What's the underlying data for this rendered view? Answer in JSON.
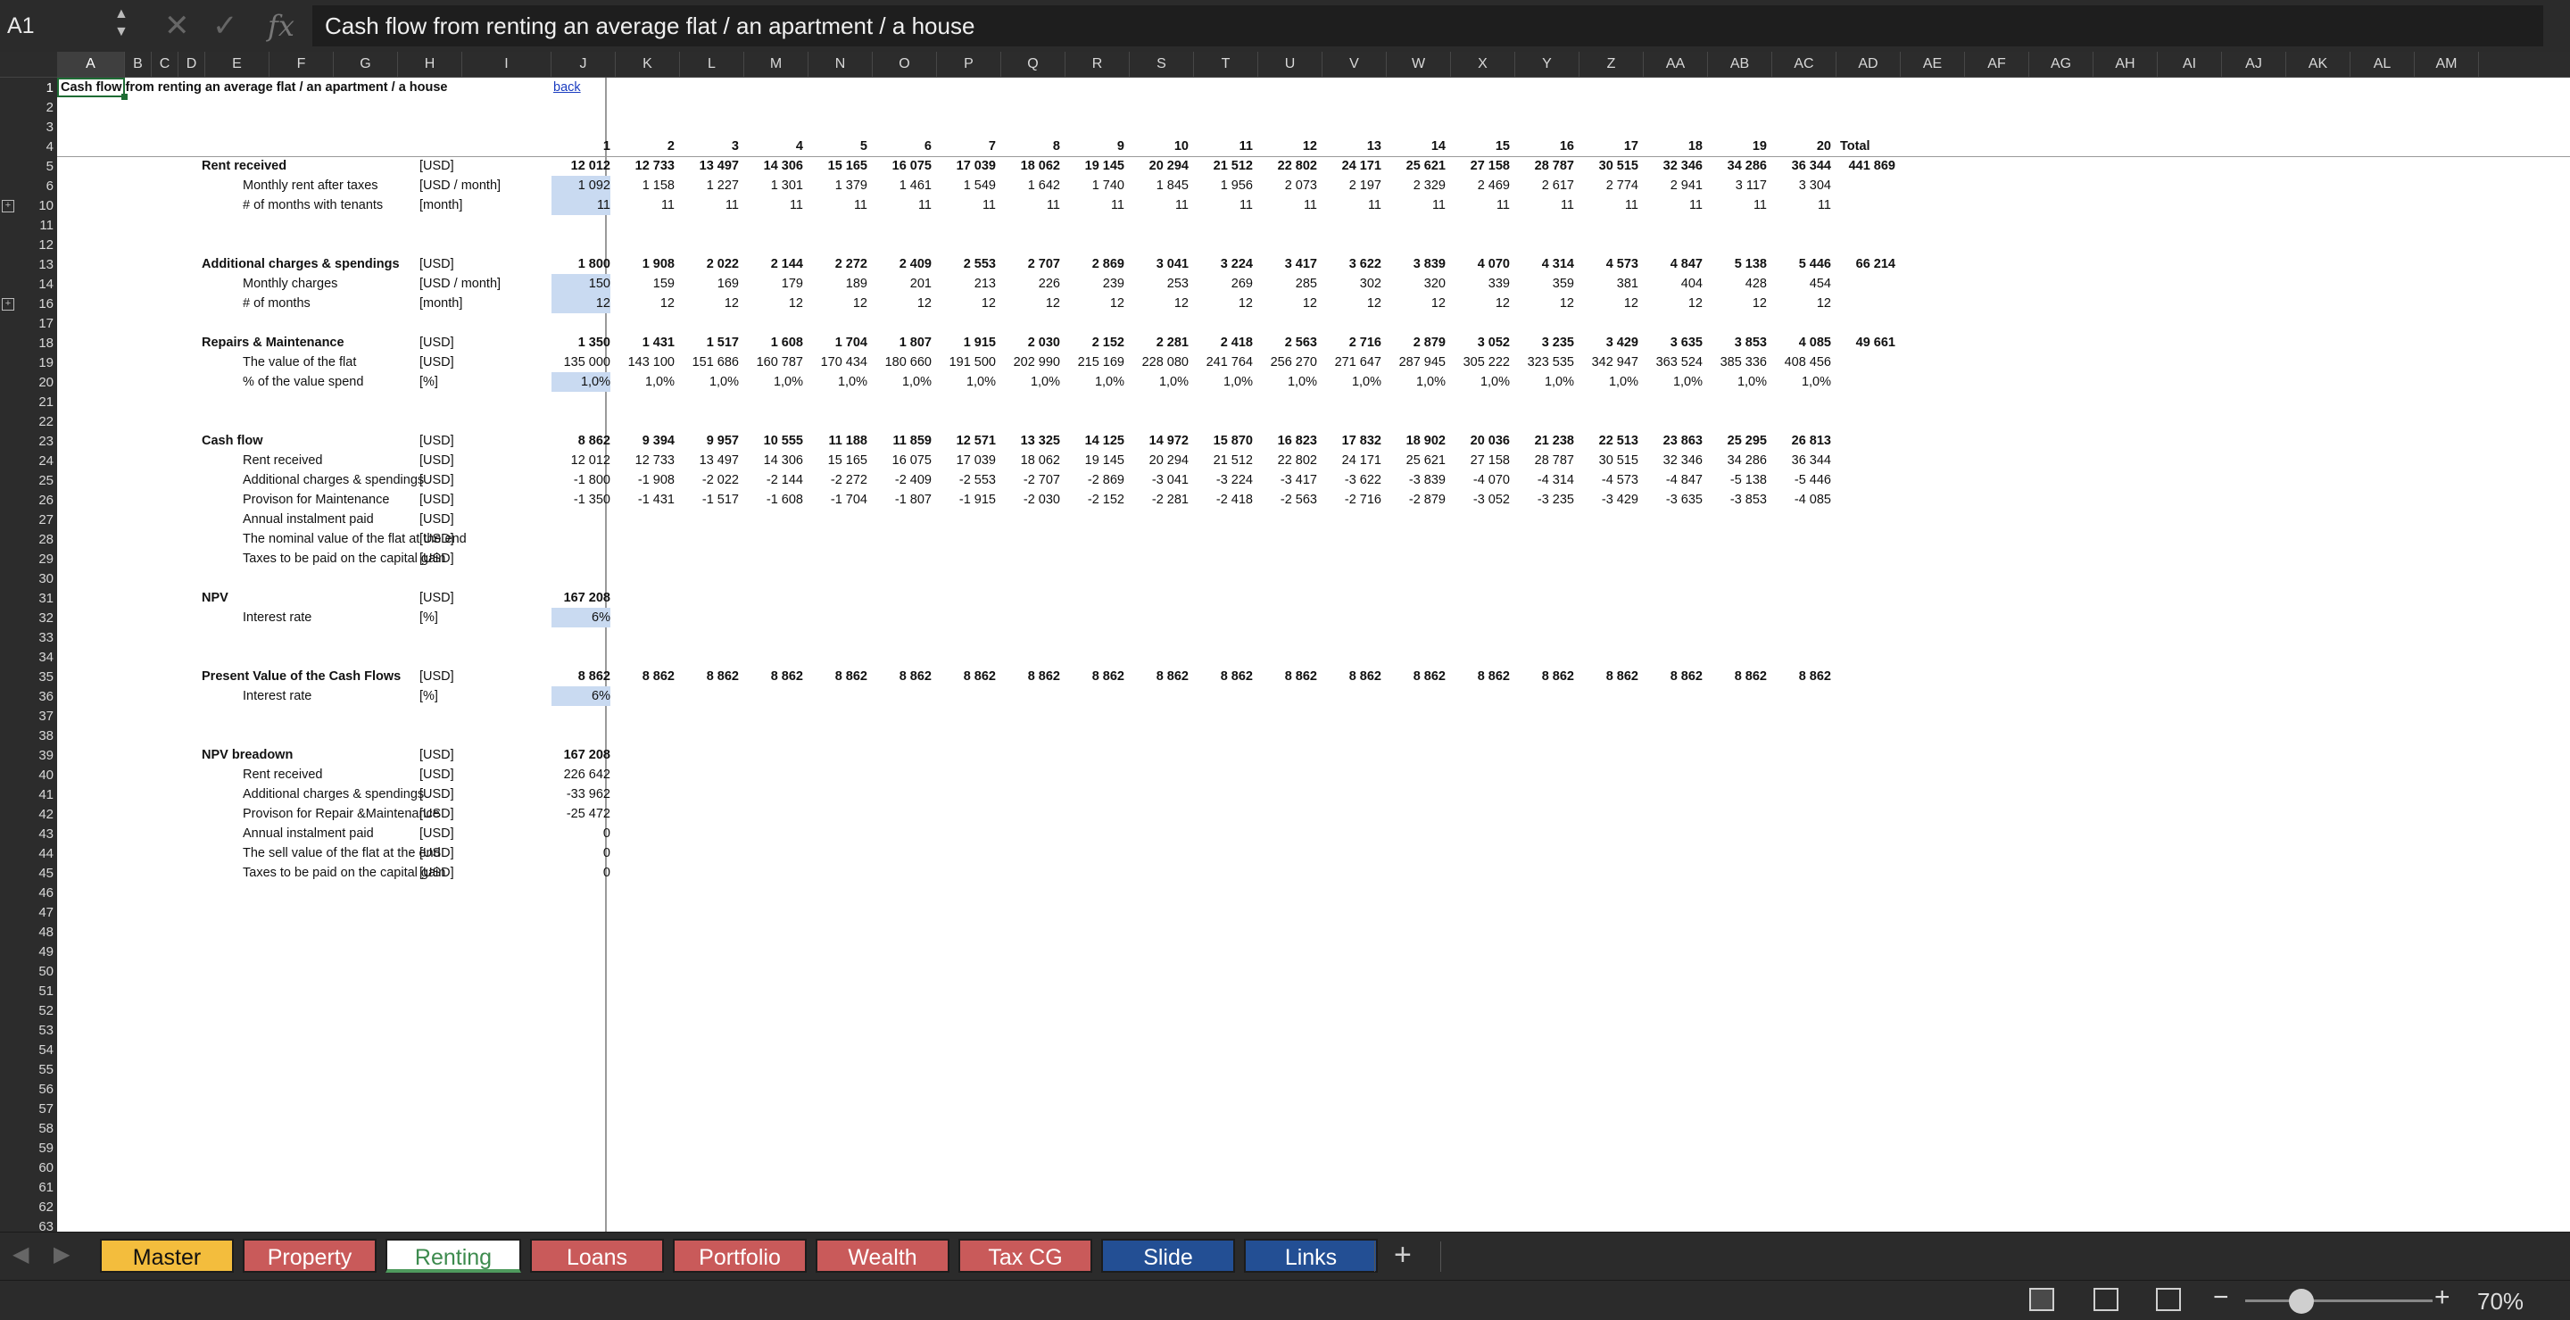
{
  "formula_bar": {
    "cell_ref": "A1",
    "formula": "Cash flow from renting an average flat / an apartment / a house",
    "fx_label": "fx",
    "cancel_icon": "x-icon",
    "enter_icon": "check-icon"
  },
  "outline_levels": [
    "1",
    "2"
  ],
  "columns": [
    "A",
    "B",
    "C",
    "D",
    "E",
    "F",
    "G",
    "H",
    "I",
    "J",
    "K",
    "L",
    "M",
    "N",
    "O",
    "P",
    "Q",
    "R",
    "S",
    "T",
    "U",
    "V",
    "W",
    "X",
    "Y",
    "Z",
    "AA",
    "AB",
    "AC",
    "AD",
    "AE",
    "AF",
    "AG",
    "AH",
    "AI",
    "AJ",
    "AK",
    "AL",
    "AM"
  ],
  "row_numbers": [
    "1",
    "2",
    "3",
    "4",
    "5",
    "6",
    "10",
    "11",
    "12",
    "13",
    "14",
    "16",
    "17",
    "18",
    "19",
    "20",
    "21",
    "22",
    "23",
    "24",
    "25",
    "26",
    "27",
    "28",
    "29",
    "30",
    "31",
    "32",
    "33",
    "34",
    "35",
    "36",
    "37",
    "38",
    "39",
    "40",
    "41",
    "42",
    "43",
    "44",
    "45",
    "46",
    "47",
    "48",
    "49",
    "50",
    "51",
    "52",
    "53",
    "54",
    "55",
    "56",
    "57",
    "58",
    "59",
    "60",
    "61",
    "62",
    "63"
  ],
  "sheet": {
    "title": "Cash flow from renting an average flat / an apartment / a house",
    "back_link": "back",
    "years": [
      "1",
      "2",
      "3",
      "4",
      "5",
      "6",
      "7",
      "8",
      "9",
      "10",
      "11",
      "12",
      "13",
      "14",
      "15",
      "16",
      "17",
      "18",
      "19",
      "20"
    ],
    "total_label": "Total",
    "rows": [
      {
        "row": "5",
        "label": "Rent received",
        "unit": "[USD]",
        "bold": true,
        "values": [
          "12 012",
          "12 733",
          "13 497",
          "14 306",
          "15 165",
          "16 075",
          "17 039",
          "18 062",
          "19 145",
          "20 294",
          "21 512",
          "22 802",
          "24 171",
          "25 621",
          "27 158",
          "28 787",
          "30 515",
          "32 346",
          "34 286",
          "36 344"
        ],
        "total": "441 869"
      },
      {
        "row": "6",
        "label": "Monthly rent after taxes",
        "unit": "[USD / month]",
        "indent": true,
        "hl": true,
        "values": [
          "1 092",
          "1 158",
          "1 227",
          "1 301",
          "1 379",
          "1 461",
          "1 549",
          "1 642",
          "1 740",
          "1 845",
          "1 956",
          "2 073",
          "2 197",
          "2 329",
          "2 469",
          "2 617",
          "2 774",
          "2 941",
          "3 117",
          "3 304"
        ]
      },
      {
        "row": "10",
        "label": "# of months with tenants",
        "unit": "[month]",
        "indent": true,
        "hl": true,
        "values": [
          "11",
          "11",
          "11",
          "11",
          "11",
          "11",
          "11",
          "11",
          "11",
          "11",
          "11",
          "11",
          "11",
          "11",
          "11",
          "11",
          "11",
          "11",
          "11",
          "11"
        ]
      },
      {
        "row": "13",
        "label": "Additional charges & spendings",
        "unit": "[USD]",
        "bold": true,
        "values": [
          "1 800",
          "1 908",
          "2 022",
          "2 144",
          "2 272",
          "2 409",
          "2 553",
          "2 707",
          "2 869",
          "3 041",
          "3 224",
          "3 417",
          "3 622",
          "3 839",
          "4 070",
          "4 314",
          "4 573",
          "4 847",
          "5 138",
          "5 446"
        ],
        "total": "66 214"
      },
      {
        "row": "14",
        "label": "Monthly charges",
        "unit": "[USD / month]",
        "indent": true,
        "hl": true,
        "values": [
          "150",
          "159",
          "169",
          "179",
          "189",
          "201",
          "213",
          "226",
          "239",
          "253",
          "269",
          "285",
          "302",
          "320",
          "339",
          "359",
          "381",
          "404",
          "428",
          "454"
        ]
      },
      {
        "row": "16",
        "label": "# of months",
        "unit": "[month]",
        "indent": true,
        "hl": true,
        "values": [
          "12",
          "12",
          "12",
          "12",
          "12",
          "12",
          "12",
          "12",
          "12",
          "12",
          "12",
          "12",
          "12",
          "12",
          "12",
          "12",
          "12",
          "12",
          "12",
          "12"
        ]
      },
      {
        "row": "18",
        "label": "Repairs & Maintenance",
        "unit": "[USD]",
        "bold": true,
        "values": [
          "1 350",
          "1 431",
          "1 517",
          "1 608",
          "1 704",
          "1 807",
          "1 915",
          "2 030",
          "2 152",
          "2 281",
          "2 418",
          "2 563",
          "2 716",
          "2 879",
          "3 052",
          "3 235",
          "3 429",
          "3 635",
          "3 853",
          "4 085"
        ],
        "total": "49 661"
      },
      {
        "row": "19",
        "label": "The value of the flat",
        "unit": "[USD]",
        "indent": true,
        "values": [
          "135 000",
          "143 100",
          "151 686",
          "160 787",
          "170 434",
          "180 660",
          "191 500",
          "202 990",
          "215 169",
          "228 080",
          "241 764",
          "256 270",
          "271 647",
          "287 945",
          "305 222",
          "323 535",
          "342 947",
          "363 524",
          "385 336",
          "408 456"
        ]
      },
      {
        "row": "20",
        "label": "% of the value spend",
        "unit": "[%]",
        "indent": true,
        "hl": true,
        "values": [
          "1,0%",
          "1,0%",
          "1,0%",
          "1,0%",
          "1,0%",
          "1,0%",
          "1,0%",
          "1,0%",
          "1,0%",
          "1,0%",
          "1,0%",
          "1,0%",
          "1,0%",
          "1,0%",
          "1,0%",
          "1,0%",
          "1,0%",
          "1,0%",
          "1,0%",
          "1,0%"
        ]
      },
      {
        "row": "23",
        "label": "Cash flow",
        "unit": "[USD]",
        "bold": true,
        "values": [
          "8 862",
          "9 394",
          "9 957",
          "10 555",
          "11 188",
          "11 859",
          "12 571",
          "13 325",
          "14 125",
          "14 972",
          "15 870",
          "16 823",
          "17 832",
          "18 902",
          "20 036",
          "21 238",
          "22 513",
          "23 863",
          "25 295",
          "26 813"
        ]
      },
      {
        "row": "24",
        "label": "Rent received",
        "unit": "[USD]",
        "indent": true,
        "values": [
          "12 012",
          "12 733",
          "13 497",
          "14 306",
          "15 165",
          "16 075",
          "17 039",
          "18 062",
          "19 145",
          "20 294",
          "21 512",
          "22 802",
          "24 171",
          "25 621",
          "27 158",
          "28 787",
          "30 515",
          "32 346",
          "34 286",
          "36 344"
        ]
      },
      {
        "row": "25",
        "label": "Additional charges & spendings",
        "unit": "[USD]",
        "indent": true,
        "values": [
          "-1 800",
          "-1 908",
          "-2 022",
          "-2 144",
          "-2 272",
          "-2 409",
          "-2 553",
          "-2 707",
          "-2 869",
          "-3 041",
          "-3 224",
          "-3 417",
          "-3 622",
          "-3 839",
          "-4 070",
          "-4 314",
          "-4 573",
          "-4 847",
          "-5 138",
          "-5 446"
        ]
      },
      {
        "row": "26",
        "label": "Provison for Maintenance",
        "unit": "[USD]",
        "indent": true,
        "values": [
          "-1 350",
          "-1 431",
          "-1 517",
          "-1 608",
          "-1 704",
          "-1 807",
          "-1 915",
          "-2 030",
          "-2 152",
          "-2 281",
          "-2 418",
          "-2 563",
          "-2 716",
          "-2 879",
          "-3 052",
          "-3 235",
          "-3 429",
          "-3 635",
          "-3 853",
          "-4 085"
        ]
      },
      {
        "row": "27",
        "label": "Annual instalment paid",
        "unit": "[USD]",
        "indent": true,
        "values": []
      },
      {
        "row": "28",
        "label": "The nominal value of the flat at the end",
        "unit": "[USD]",
        "indent": true,
        "values": []
      },
      {
        "row": "29",
        "label": "Taxes to be paid on the capital gain",
        "unit": "[USD]",
        "indent": true,
        "values": []
      },
      {
        "row": "31",
        "label": "NPV",
        "unit": "[USD]",
        "bold": true,
        "values": [
          "167 208"
        ]
      },
      {
        "row": "32",
        "label": "Interest rate",
        "unit": "[%]",
        "indent": true,
        "hl": true,
        "values": [
          "6%"
        ]
      },
      {
        "row": "35",
        "label": "Present Value of the Cash Flows",
        "unit": "[USD]",
        "bold": true,
        "values": [
          "8 862",
          "8 862",
          "8 862",
          "8 862",
          "8 862",
          "8 862",
          "8 862",
          "8 862",
          "8 862",
          "8 862",
          "8 862",
          "8 862",
          "8 862",
          "8 862",
          "8 862",
          "8 862",
          "8 862",
          "8 862",
          "8 862",
          "8 862"
        ]
      },
      {
        "row": "36",
        "label": "Interest rate",
        "unit": "[%]",
        "indent": true,
        "hl": true,
        "values": [
          "6%"
        ]
      },
      {
        "row": "39",
        "label": "NPV breadown",
        "unit": "[USD]",
        "bold": true,
        "values": [
          "167 208"
        ]
      },
      {
        "row": "40",
        "label": "Rent received",
        "unit": "[USD]",
        "indent": true,
        "values": [
          "226 642"
        ]
      },
      {
        "row": "41",
        "label": "Additional charges & spendings",
        "unit": "[USD]",
        "indent": true,
        "values": [
          "-33 962"
        ]
      },
      {
        "row": "42",
        "label": "Provison for  Repair &Maintenance",
        "unit": "[USD]",
        "indent": true,
        "values": [
          "-25 472"
        ]
      },
      {
        "row": "43",
        "label": "Annual instalment paid",
        "unit": "[USD]",
        "indent": true,
        "values": [
          "0"
        ]
      },
      {
        "row": "44",
        "label": "The sell value of the flat at the end",
        "unit": "[USD]",
        "indent": true,
        "values": [
          "0"
        ]
      },
      {
        "row": "45",
        "label": "Taxes to be paid on the capital gain",
        "unit": "[USD]",
        "indent": true,
        "values": [
          "0"
        ]
      }
    ]
  },
  "tabs": [
    {
      "label": "Master",
      "color": "#f3bd3d",
      "text": "#111111",
      "active": false
    },
    {
      "label": "Property",
      "color": "#c95a5a",
      "text": "#ffffff",
      "active": false
    },
    {
      "label": "Renting",
      "color": "#ffffff",
      "text": "#3d8b4e",
      "active": true
    },
    {
      "label": "Loans",
      "color": "#c95a5a",
      "text": "#ffffff",
      "active": false
    },
    {
      "label": "Portfolio",
      "color": "#c95a5a",
      "text": "#ffffff",
      "active": false
    },
    {
      "label": "Wealth",
      "color": "#c95a5a",
      "text": "#ffffff",
      "active": false
    },
    {
      "label": "Tax CG",
      "color": "#c95a5a",
      "text": "#ffffff",
      "active": false
    },
    {
      "label": "Slide",
      "color": "#234f94",
      "text": "#ffffff",
      "active": false
    },
    {
      "label": "Links",
      "color": "#234f94",
      "text": "#ffffff",
      "active": false
    }
  ],
  "add_sheet_label": "+",
  "status": {
    "zoom": "70%",
    "zoom_fraction": 0.3,
    "minus": "−",
    "plus": "+"
  }
}
